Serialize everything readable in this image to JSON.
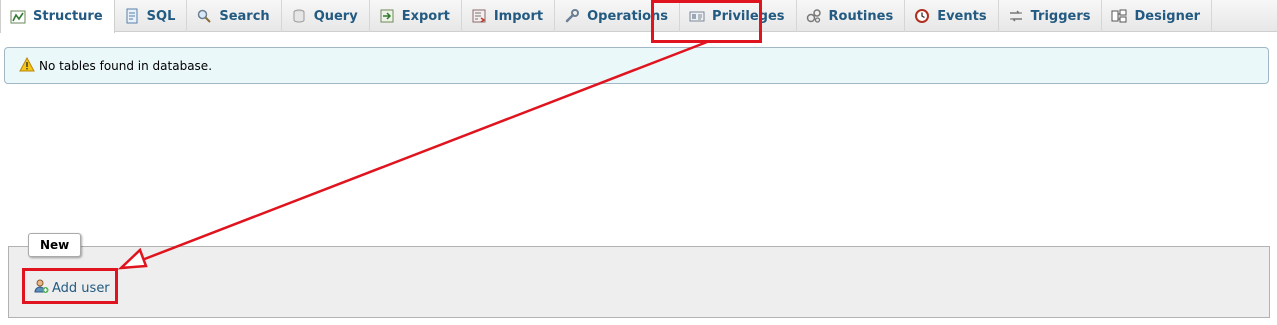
{
  "tabs": [
    {
      "label": "Structure",
      "icon": "structure-icon",
      "active": true
    },
    {
      "label": "SQL",
      "icon": "sql-icon",
      "active": false
    },
    {
      "label": "Search",
      "icon": "search-icon",
      "active": false
    },
    {
      "label": "Query",
      "icon": "query-icon",
      "active": false
    },
    {
      "label": "Export",
      "icon": "export-icon",
      "active": false
    },
    {
      "label": "Import",
      "icon": "import-icon",
      "active": false
    },
    {
      "label": "Operations",
      "icon": "wrench-icon",
      "active": false
    },
    {
      "label": "Privileges",
      "icon": "privileges-icon",
      "active": false
    },
    {
      "label": "Routines",
      "icon": "routines-icon",
      "active": false
    },
    {
      "label": "Events",
      "icon": "clock-icon",
      "active": false
    },
    {
      "label": "Triggers",
      "icon": "triggers-icon",
      "active": false
    },
    {
      "label": "Designer",
      "icon": "designer-icon",
      "active": false
    }
  ],
  "notice": {
    "icon": "warning-icon",
    "text": "No tables found in database."
  },
  "new_section": {
    "legend": "New",
    "add_user_label": "Add user",
    "add_user_icon": "add-user-icon"
  },
  "colors": {
    "link": "#235a81",
    "highlight": "#e0141e",
    "notice_bg": "#ebf8fa",
    "fieldset_bg": "#eeeeee"
  }
}
